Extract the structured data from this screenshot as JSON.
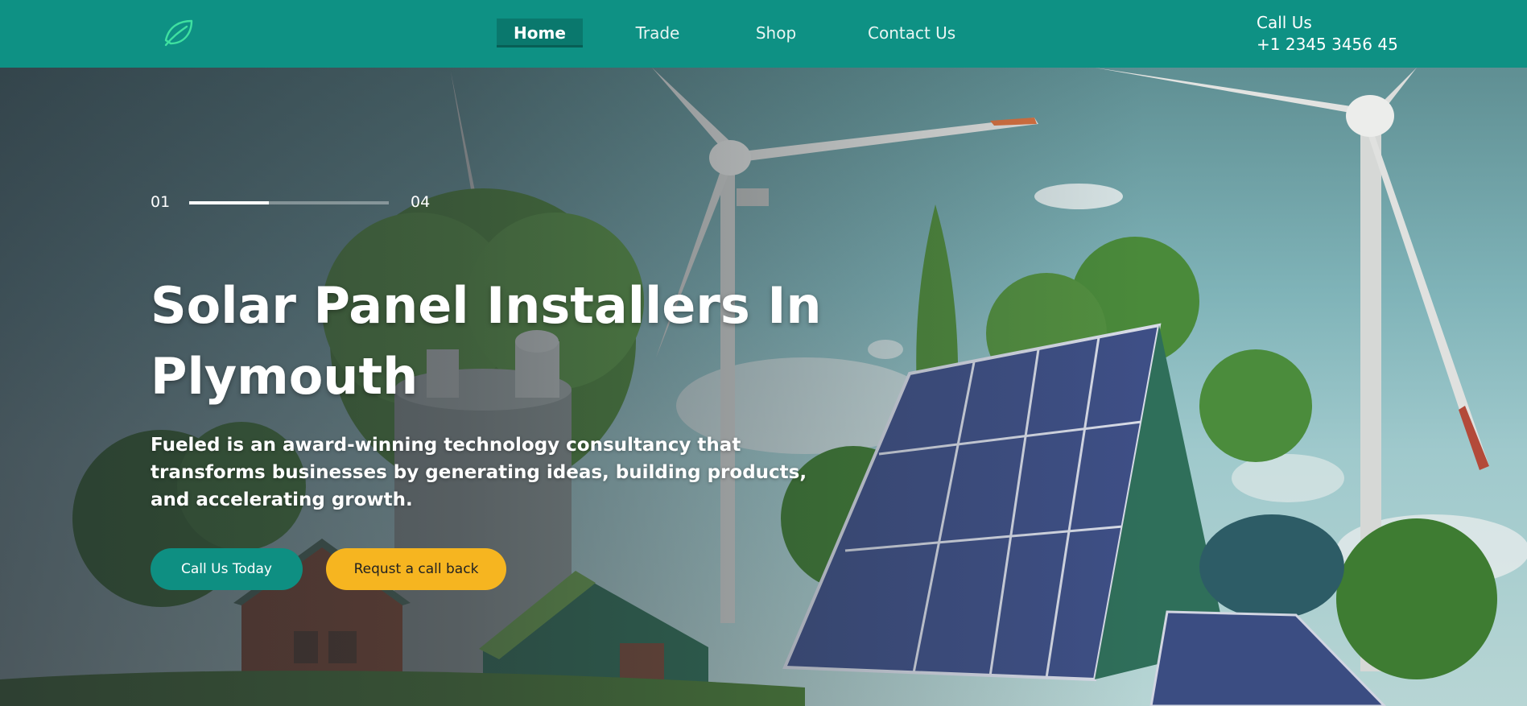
{
  "header": {
    "logo_icon": "leaf-icon",
    "nav": [
      {
        "label": "Home",
        "active": true
      },
      {
        "label": "Trade",
        "active": false
      },
      {
        "label": "Shop",
        "active": false
      },
      {
        "label": "Contact Us",
        "active": false
      }
    ],
    "call_label": "Call Us",
    "phone": "+1 2345 3456 45"
  },
  "hero": {
    "slider": {
      "current": "01",
      "total": "04",
      "progress": 0.4
    },
    "title_line1": "Solar Panel Installers In",
    "title_line2": "Plymouth",
    "subtitle": "Fueled is an award-winning technology consultancy that transforms businesses by generating ideas, building products, and accelerating growth.",
    "primary_button": "Call Us Today",
    "secondary_button": "Requst a call back",
    "background": "wind-turbines-solar-panels-illustration"
  },
  "colors": {
    "brand_teal": "#0e9184",
    "accent_yellow": "#f6b520",
    "text_white": "#ffffff"
  }
}
